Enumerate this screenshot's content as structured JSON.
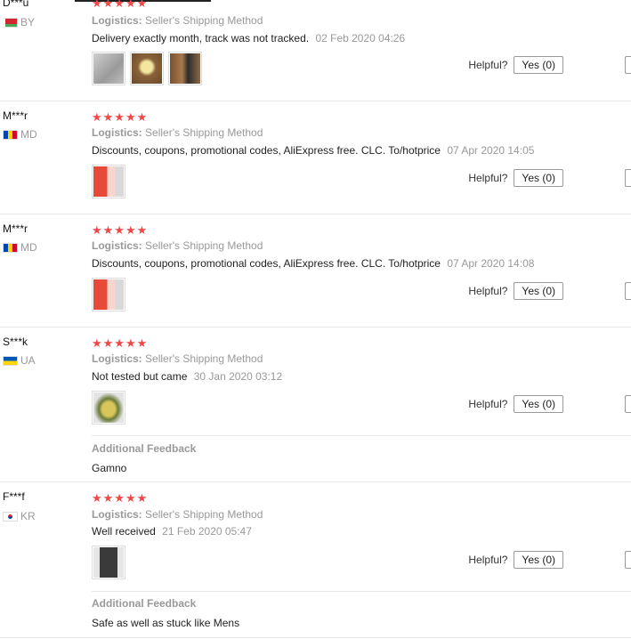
{
  "colors": {
    "star": "#f04848",
    "muted": "#999999"
  },
  "reviews": [
    {
      "user": "D***u",
      "country": "BY",
      "stars": "★★★★★",
      "logistics_label": "Logistics:",
      "logistics_value": "Seller's Shipping Method",
      "text": "Delivery exactly month, track was not tracked.",
      "date": "02 Feb 2020 04:26",
      "helpful_label": "Helpful?",
      "yes_label": "Yes (0)"
    },
    {
      "user": "M***r",
      "country": "MD",
      "stars": "★★★★★",
      "logistics_label": "Logistics:",
      "logistics_value": "Seller's Shipping Method",
      "text": "Discounts, coupons, promotional codes, AliExpress free. CLC. To/hotprice",
      "date": "07 Apr 2020 14:05",
      "helpful_label": "Helpful?",
      "yes_label": "Yes (0)"
    },
    {
      "user": "M***r",
      "country": "MD",
      "stars": "★★★★★",
      "logistics_label": "Logistics:",
      "logistics_value": "Seller's Shipping Method",
      "text": "Discounts, coupons, promotional codes, AliExpress free. CLC. To/hotprice",
      "date": "07 Apr 2020 14:08",
      "helpful_label": "Helpful?",
      "yes_label": "Yes (0)"
    },
    {
      "user": "S***k",
      "country": "UA",
      "stars": "★★★★★",
      "logistics_label": "Logistics:",
      "logistics_value": "Seller's Shipping Method",
      "text": "Not tested but came",
      "date": "30 Jan 2020 03:12",
      "helpful_label": "Helpful?",
      "yes_label": "Yes (0)",
      "additional_label": "Additional Feedback",
      "additional_text": "Gamno"
    },
    {
      "user": "F***f",
      "country": "KR",
      "stars": "★★★★★",
      "logistics_label": "Logistics:",
      "logistics_value": "Seller's Shipping Method",
      "text": "Well received",
      "date": "21 Feb 2020 05:47",
      "helpful_label": "Helpful?",
      "yes_label": "Yes (0)",
      "additional_label": "Additional Feedback",
      "additional_text": "Safe as well as stuck like Mens"
    }
  ]
}
